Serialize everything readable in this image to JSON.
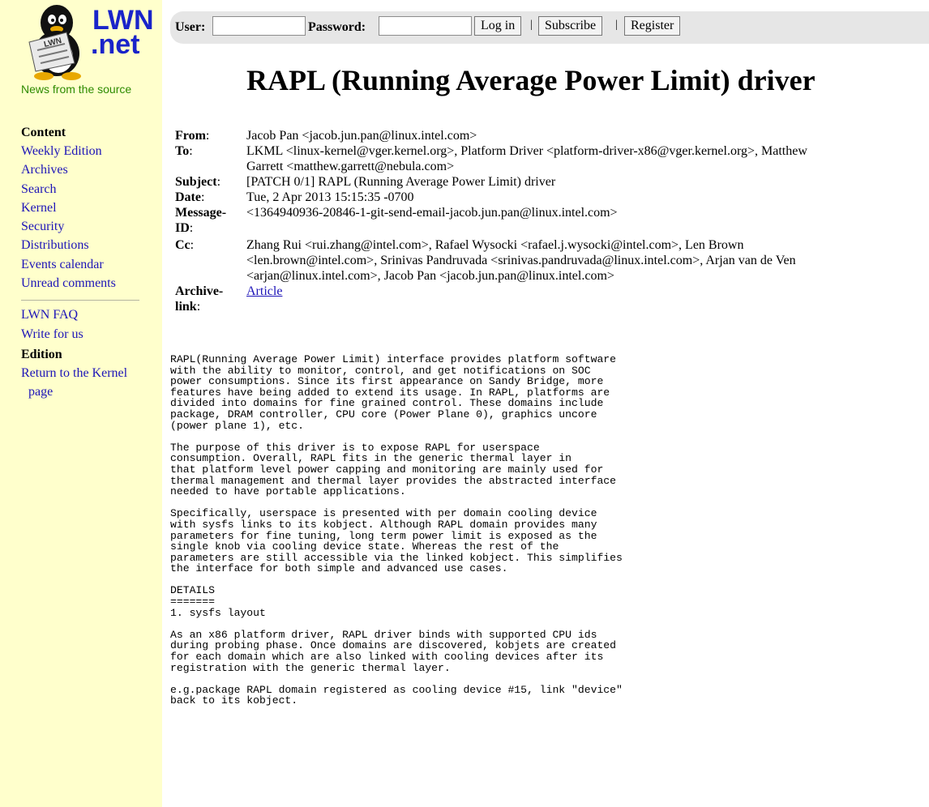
{
  "site": {
    "logo_text_line1": "LWN",
    "logo_text_line2": ".net",
    "logo_badge": "LWN",
    "tagline": "News from the source"
  },
  "sidebar": {
    "content_heading": "Content",
    "content_links": [
      "Weekly Edition",
      "Archives",
      "Search",
      "Kernel",
      "Security",
      "Distributions",
      "Events calendar",
      "Unread comments"
    ],
    "faq_links": [
      "LWN FAQ",
      "Write for us"
    ],
    "edition_heading": "Edition",
    "edition_link_line1": "Return to the Kernel",
    "edition_link_line2": "page"
  },
  "login": {
    "user_label": "User:",
    "password_label": "Password:",
    "user_value": "",
    "password_value": "",
    "login_button": "Log in",
    "subscribe_button": "Subscribe",
    "register_button": "Register",
    "separator": "|"
  },
  "article": {
    "title": "RAPL (Running Average Power Limit) driver",
    "headers": {
      "from_label": "From",
      "from_value": "Jacob Pan <jacob.jun.pan@linux.intel.com>",
      "to_label": "To",
      "to_value_line1": "LKML <linux-kernel@vger.kernel.org>, Platform Driver <platform-driver-x86@vger.kernel.org>, Matthew",
      "to_value_line2": "Garrett <matthew.garrett@nebula.com>",
      "subject_label": "Subject",
      "subject_value": "[PATCH 0/1] RAPL (Running Average Power Limit) driver",
      "date_label": "Date",
      "date_value": "Tue, 2 Apr 2013 15:15:35 -0700",
      "msgid_label_line1": "Message-",
      "msgid_label_line2": "ID",
      "msgid_value": "<1364940936-20846-1-git-send-email-jacob.jun.pan@linux.intel.com>",
      "cc_label": "Cc",
      "cc_value_line1": "Zhang Rui <rui.zhang@intel.com>, Rafael Wysocki <rafael.j.wysocki@intel.com>, Len Brown",
      "cc_value_line2": "<len.brown@intel.com>, Srinivas Pandruvada <srinivas.pandruvada@linux.intel.com>, Arjan van de Ven",
      "cc_value_line3": "<arjan@linux.intel.com>, Jacob Pan <jacob.jun.pan@linux.intel.com>",
      "archive_label_line1": "Archive-",
      "archive_label_line2": "link",
      "archive_link": "Article"
    },
    "body": "RAPL(Running Average Power Limit) interface provides platform software\nwith the ability to monitor, control, and get notifications on SOC\npower consumptions. Since its first appearance on Sandy Bridge, more\nfeatures have being added to extend its usage. In RAPL, platforms are\ndivided into domains for fine grained control. These domains include\npackage, DRAM controller, CPU core (Power Plane 0), graphics uncore\n(power plane 1), etc.\n\nThe purpose of this driver is to expose RAPL for userspace\nconsumption. Overall, RAPL fits in the generic thermal layer in\nthat platform level power capping and monitoring are mainly used for\nthermal management and thermal layer provides the abstracted interface\nneeded to have portable applications.\n\nSpecifically, userspace is presented with per domain cooling device\nwith sysfs links to its kobject. Although RAPL domain provides many\nparameters for fine tuning, long term power limit is exposed as the\nsingle knob via cooling device state. Whereas the rest of the\nparameters are still accessible via the linked kobject. This simplifies\nthe interface for both simple and advanced use cases.\n\nDETAILS\n=======\n1. sysfs layout\n\nAs an x86 platform driver, RAPL driver binds with supported CPU ids\nduring probing phase. Once domains are discovered, kobjets are created\nfor each domain which are also linked with cooling devices after its\nregistration with the generic thermal layer.\n\ne.g.package RAPL domain registered as cooling device #15, link \"device\"\nback to its kobject."
  },
  "colors": {
    "sidebar_bg": "#ffffcc",
    "link": "#1d14b8",
    "tagline": "#2e8b00",
    "topbar_bg": "#e6e6e6",
    "logo_blue": "#1a24c9"
  },
  "icons": {
    "logo": "tux-penguin-reading-newspaper-icon"
  }
}
